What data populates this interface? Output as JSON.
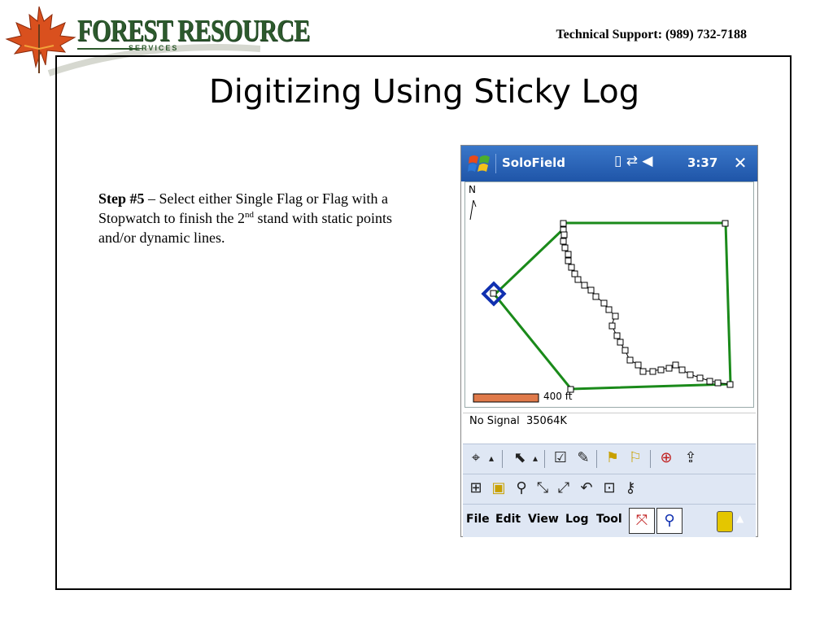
{
  "header": {
    "brand_name": "FOREST RESOURCE",
    "brand_sub": "SERVICES",
    "support_text": "Technical Support: (989) 732-7188"
  },
  "slide": {
    "title": "Digitizing Using Sticky Log",
    "step_label": "Step #5",
    "step_text_1": " – Select either Single Flag or Flag with a Stopwatch to finish the 2",
    "step_sup": "nd",
    "step_text_2": " stand with static points and/or dynamic lines."
  },
  "device": {
    "app_title": "SoloField",
    "clock": "3:37",
    "close_label": "✕",
    "map": {
      "north_label": "N",
      "scale_label": "400 ft",
      "scale_color": "#e07a4a",
      "line_color": "#1a8a1a",
      "marker_color": "#1030b0"
    },
    "status": {
      "signal": "No Signal",
      "memory": "35064K"
    },
    "menu": {
      "file": "File",
      "edit": "Edit",
      "view": "View",
      "log": "Log",
      "tool": "Tool"
    },
    "icons": [
      "windows-start-icon",
      "battery-icon",
      "connectivity-icon",
      "volume-icon",
      "close-icon",
      "gps-target-icon",
      "pointer-select-icon",
      "checkbox-icon",
      "eraser-icon",
      "single-flag-icon",
      "flag-stopwatch-icon",
      "compass-icon",
      "upload-icon",
      "pan-icon",
      "layer-icon",
      "zoom-icon",
      "zoom-in-icon",
      "zoom-out-icon",
      "undo-icon",
      "edit-attribute-icon",
      "identify-icon",
      "sticky-log-icon",
      "zoom-select-icon",
      "gps-status-icon"
    ]
  }
}
